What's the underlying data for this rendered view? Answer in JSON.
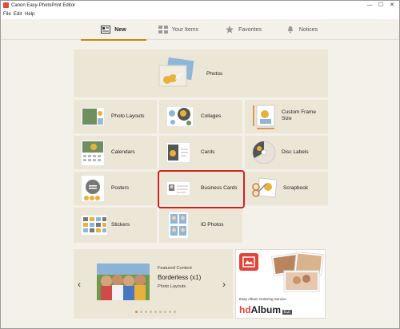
{
  "window": {
    "title": "Canon Easy-PhotoPrint Editor",
    "controls": {
      "minimize": "—",
      "maximize": "☐",
      "close": "✕"
    }
  },
  "menu": {
    "items": [
      "File",
      "Edit",
      "Help"
    ]
  },
  "tabs": [
    {
      "label": "New",
      "icon": "new-document-icon",
      "active": true
    },
    {
      "label": "Your Items",
      "icon": "grid-icon",
      "active": false
    },
    {
      "label": "Favorites",
      "icon": "star-icon",
      "active": false
    },
    {
      "label": "Notices",
      "icon": "bell-icon",
      "active": false
    }
  ],
  "tiles": {
    "photos": "Photos",
    "photo_layouts": "Photo Layouts",
    "collages": "Collages",
    "custom_frame_size": "Custom Frame Size",
    "calendars": "Calendars",
    "cards": "Cards",
    "disc_labels": "Disc Labels",
    "posters": "Posters",
    "business_cards": "Business Cards",
    "scrapbook": "Scrapbook",
    "stickers": "Stickers",
    "id_photos": "ID Photos"
  },
  "selected_tile": "business_cards",
  "featured": {
    "caption": "Featured Content",
    "title": "Borderless (x1)",
    "subtitle": "Photo Layouts",
    "prev": "‹",
    "next": "›",
    "dot_count": 9,
    "active_dot": 0
  },
  "album_ad": {
    "service_text": "Easy Album Ordering Service",
    "brand_hd": "hd",
    "brand_album": "Album",
    "brand_ez": "EZ"
  },
  "colors": {
    "accent": "#c8880c",
    "selection": "#d02020",
    "tile_bg": "#ece6d6",
    "flower": "#e8b23a"
  }
}
